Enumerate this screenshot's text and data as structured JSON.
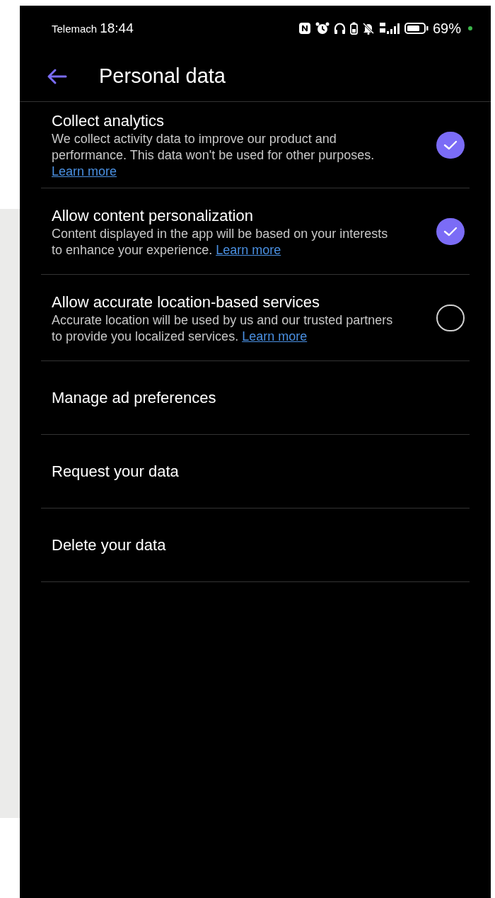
{
  "status_bar": {
    "carrier": "Telemach",
    "time": "18:44",
    "battery": "69%"
  },
  "header": {
    "title": "Personal data"
  },
  "settings": [
    {
      "title": "Collect analytics",
      "description": "We collect activity data to improve our product and performance. This data won't be used for other purposes.",
      "link": "Learn more",
      "checked": true
    },
    {
      "title": "Allow content personalization",
      "description": "Content displayed in the app will be based on your interests to enhance your experience.",
      "link": "Learn more",
      "checked": true
    },
    {
      "title": "Allow accurate location-based services",
      "description": "Accurate location will be used by us and our trusted partners to provide you localized services.",
      "link": "Learn more",
      "checked": false
    }
  ],
  "menu": [
    {
      "label": "Manage ad preferences"
    },
    {
      "label": "Request your data"
    },
    {
      "label": "Delete your data"
    }
  ]
}
